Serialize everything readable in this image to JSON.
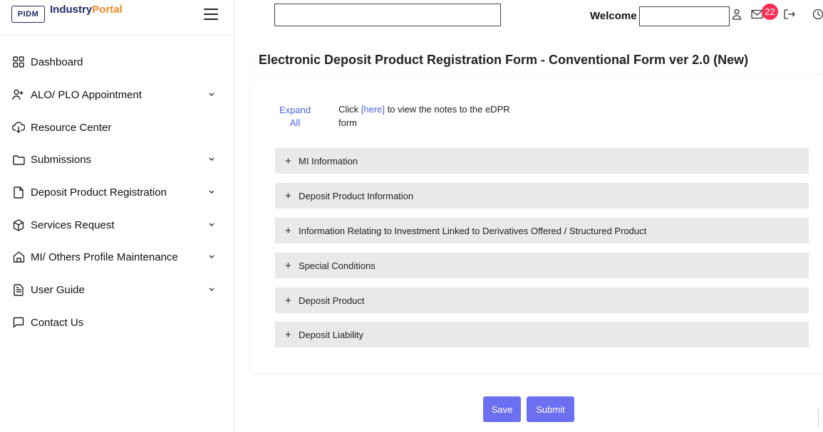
{
  "brand": {
    "logo_text": "PIDM",
    "name_part1": "Industry",
    "name_part2": "Portal"
  },
  "sidebar": {
    "items": [
      {
        "label": "Dashboard",
        "icon": "grid-icon",
        "has_chevron": false
      },
      {
        "label": "ALO/ PLO Appointment",
        "icon": "user-add-icon",
        "has_chevron": true
      },
      {
        "label": "Resource Center",
        "icon": "cloud-download-icon",
        "has_chevron": false
      },
      {
        "label": "Submissions",
        "icon": "folder-icon",
        "has_chevron": true
      },
      {
        "label": "Deposit Product Registration",
        "icon": "document-icon",
        "has_chevron": true
      },
      {
        "label": "Services Request",
        "icon": "cube-icon",
        "has_chevron": true
      },
      {
        "label": "MI/ Others Profile Maintenance",
        "icon": "home-icon",
        "has_chevron": true
      },
      {
        "label": "User Guide",
        "icon": "file-text-icon",
        "has_chevron": true
      },
      {
        "label": "Contact Us",
        "icon": "chat-icon",
        "has_chevron": false
      }
    ]
  },
  "topbar": {
    "search_value": "",
    "welcome_label": "Welcome",
    "welcome_value": "",
    "mail_count": "22"
  },
  "main": {
    "title": "Electronic Deposit Product Registration Form - Conventional Form ver 2.0 (New)",
    "expand_all": "Expand All",
    "notes_prefix": "Click ",
    "notes_link": "[here]",
    "notes_suffix": " to view the notes to the eDPR form",
    "sections": [
      {
        "label": "MI Information"
      },
      {
        "label": "Deposit Product Information"
      },
      {
        "label": "Information Relating to Investment Linked to Derivatives Offered / Structured Product"
      },
      {
        "label": "Special Conditions"
      },
      {
        "label": "Deposit Product"
      },
      {
        "label": "Deposit Liability"
      }
    ],
    "save_label": "Save",
    "submit_label": "Submit"
  },
  "colors": {
    "accent": "#6b6ff0",
    "link": "#4a63e7",
    "badge": "#ff2d55",
    "brand_navy": "#1f2a6b",
    "brand_orange": "#f08a24"
  }
}
